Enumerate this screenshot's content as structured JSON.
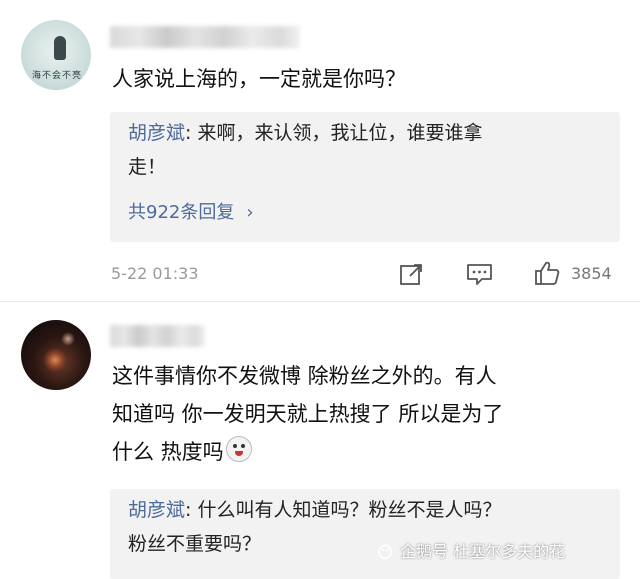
{
  "comments": [
    {
      "avatar_caption": "海不会不亮",
      "text": "人家说上海的，一定就是你吗？",
      "reply": {
        "author": "胡彦斌",
        "separator": ": ",
        "line1": "来啊，来认领，我让位，谁要谁拿",
        "line2": "走！",
        "count_label": "共922条回复",
        "chevron": "›"
      },
      "date": "5-22 01:33",
      "likes": "3854",
      "icons": [
        "share-icon",
        "comment-icon",
        "like-icon"
      ]
    },
    {
      "text_lines": [
        "这件事情你不发微博 除粉丝之外的。有人",
        "知道吗 你一发明天就上热搜了 所以是为了",
        "什么 热度吗"
      ],
      "reply": {
        "author": "胡彦斌",
        "separator": ": ",
        "line1": "什么叫有人知道吗？粉丝不是人吗？",
        "line2": "粉丝不重要吗？"
      }
    }
  ],
  "watermark": "企鹅号 杜塞尔多夫的花",
  "colors": {
    "reply_author": "#4d6b9b",
    "reply_bg": "#f2f2f2",
    "meta": "#9a9a9a"
  }
}
